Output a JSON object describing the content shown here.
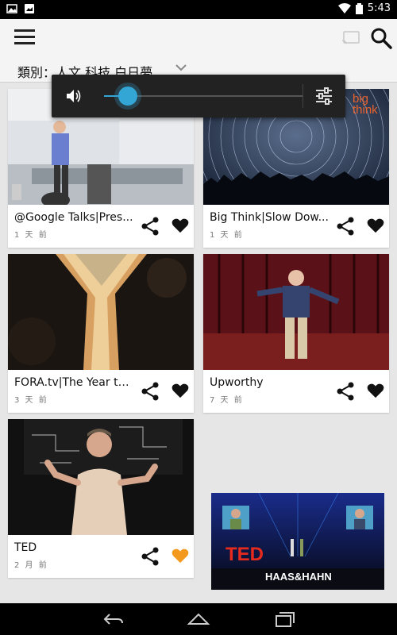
{
  "status_bar": {
    "time": "5:43",
    "icons": [
      "picture-icon",
      "photo-icon",
      "wifi-icon",
      "battery-icon"
    ]
  },
  "app_bar": {
    "icons": [
      "menu-icon",
      "cast-icon",
      "search-icon"
    ]
  },
  "category": {
    "label": "類別：人文 科技 白日夢"
  },
  "cards": [
    {
      "title": "@Google Talks|Pres...",
      "time": "1 天 前",
      "favorited": false
    },
    {
      "title": "Big Think|Slow Dow...",
      "time": "1 天 前",
      "favorited": false,
      "thumb_logo": "big think"
    },
    {
      "title": "FORA.tv|The Year th...",
      "time": "3 天 前",
      "favorited": false
    },
    {
      "title": "Upworthy",
      "time": "7 天 前",
      "favorited": false
    },
    {
      "title": "TED",
      "time": "2 月 前",
      "favorited": true
    }
  ],
  "volume": {
    "level": 0.12
  },
  "mini_player": {
    "logo": "TED",
    "caption": "HAAS&HAHN"
  },
  "colors": {
    "accent": "#33a6d6",
    "favorite_active": "#f39a1e",
    "favorite_inactive": "#111111",
    "ted_red": "#e62b1e"
  }
}
